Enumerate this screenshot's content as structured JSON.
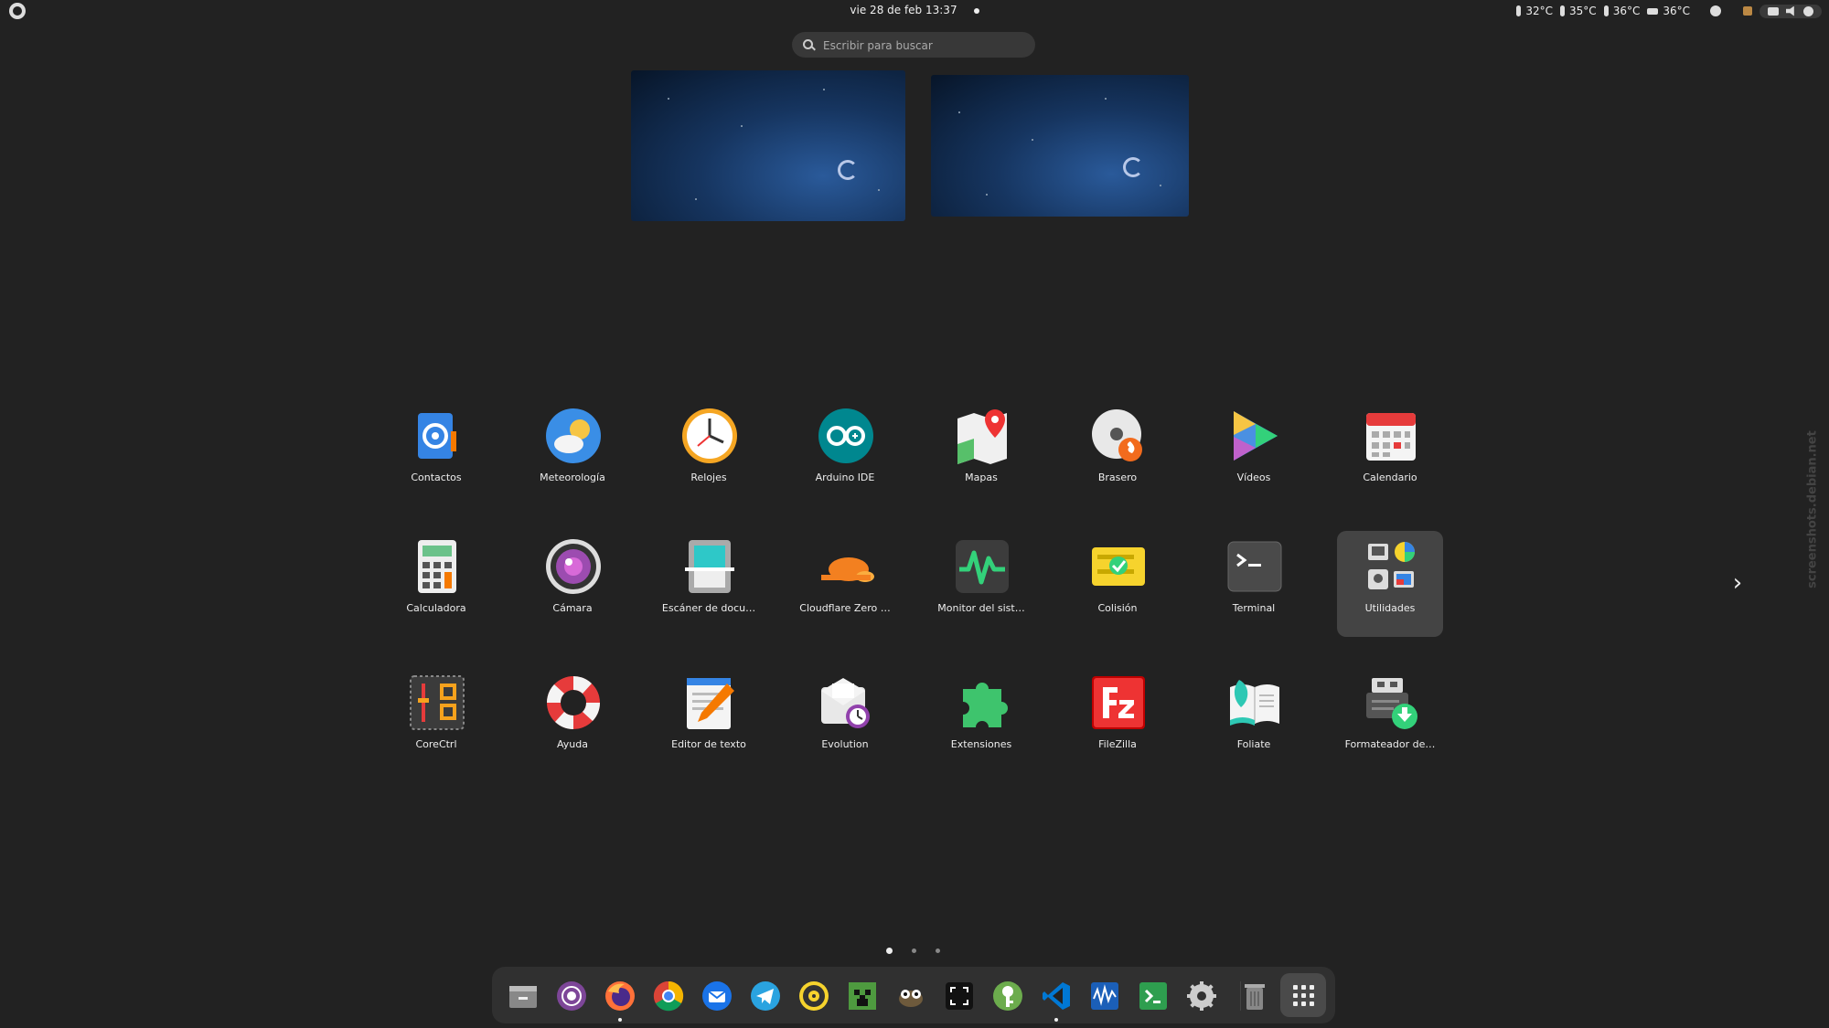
{
  "topbar": {
    "datetime": "vie 28 de feb  13:37",
    "temps": [
      "32°C",
      "35°C",
      "36°C",
      "36°C"
    ]
  },
  "search": {
    "placeholder": "Escribir para buscar"
  },
  "apps": [
    {
      "label": "Contactos",
      "icon": "contacts-icon"
    },
    {
      "label": "Meteorología",
      "icon": "weather-icon"
    },
    {
      "label": "Relojes",
      "icon": "clocks-icon"
    },
    {
      "label": "Arduino IDE",
      "icon": "arduino-icon"
    },
    {
      "label": "Mapas",
      "icon": "maps-icon"
    },
    {
      "label": "Brasero",
      "icon": "brasero-icon"
    },
    {
      "label": "Vídeos",
      "icon": "videos-icon"
    },
    {
      "label": "Calendario",
      "icon": "calendar-icon"
    },
    {
      "label": "Calculadora",
      "icon": "calculator-icon"
    },
    {
      "label": "Cámara",
      "icon": "camera-icon"
    },
    {
      "label": "Escáner de docu…",
      "icon": "scanner-icon"
    },
    {
      "label": "Cloudflare Zero …",
      "icon": "cloudflare-icon"
    },
    {
      "label": "Monitor del sist…",
      "icon": "system-monitor-icon"
    },
    {
      "label": "Colisión",
      "icon": "collision-icon"
    },
    {
      "label": "Terminal",
      "icon": "terminal-icon"
    },
    {
      "label": "Utilidades",
      "icon": "utilities-folder-icon"
    },
    {
      "label": "CoreCtrl",
      "icon": "corectrl-icon"
    },
    {
      "label": "Ayuda",
      "icon": "help-icon"
    },
    {
      "label": "Editor de texto",
      "icon": "text-editor-icon"
    },
    {
      "label": "Evolution",
      "icon": "evolution-icon"
    },
    {
      "label": "Extensiones",
      "icon": "extensions-icon"
    },
    {
      "label": "FileZilla",
      "icon": "filezilla-icon"
    },
    {
      "label": "Foliate",
      "icon": "foliate-icon"
    },
    {
      "label": "Formateador de…",
      "icon": "formatter-icon"
    }
  ],
  "selected_app": "Utilidades",
  "pages": {
    "count": 3,
    "current": 1
  },
  "dock": [
    {
      "name": "files",
      "icon": "files-icon",
      "running": false
    },
    {
      "name": "tor-browser",
      "icon": "tor-icon",
      "running": false
    },
    {
      "name": "firefox",
      "icon": "firefox-icon",
      "running": true
    },
    {
      "name": "chrome",
      "icon": "chrome-icon",
      "running": false
    },
    {
      "name": "thunderbird",
      "icon": "thunderbird-icon",
      "running": false
    },
    {
      "name": "telegram",
      "icon": "telegram-icon",
      "running": false
    },
    {
      "name": "rhythmbox",
      "icon": "rhythmbox-icon",
      "running": false
    },
    {
      "name": "minecraft",
      "icon": "minecraft-icon",
      "running": false
    },
    {
      "name": "gimp",
      "icon": "gimp-icon",
      "running": false
    },
    {
      "name": "screenshot",
      "icon": "screenshot-icon",
      "running": false
    },
    {
      "name": "keepassxc",
      "icon": "keepassxc-icon",
      "running": false
    },
    {
      "name": "vscode",
      "icon": "vscode-icon",
      "running": true
    },
    {
      "name": "waveform",
      "icon": "waveform-icon",
      "running": false
    },
    {
      "name": "terminal-green",
      "icon": "terminal-green-icon",
      "running": false
    },
    {
      "name": "settings",
      "icon": "settings-icon",
      "running": false
    },
    {
      "name": "trash",
      "icon": "trash-icon",
      "running": false
    }
  ],
  "watermark": "screenshots.debian.net"
}
